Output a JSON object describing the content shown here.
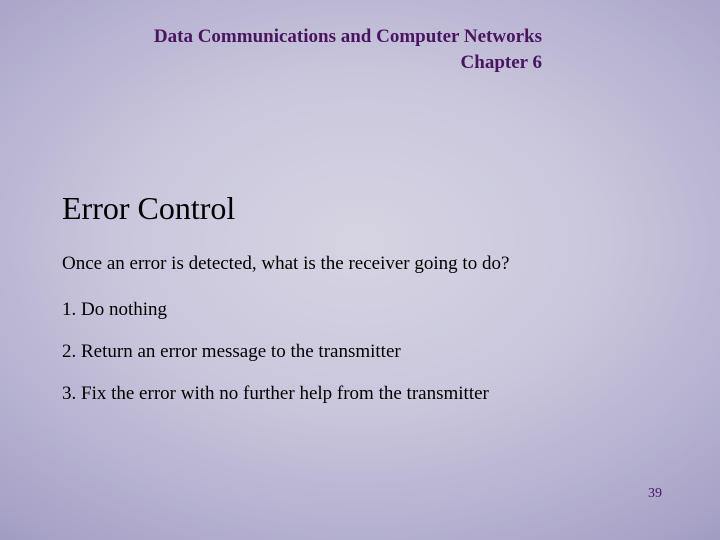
{
  "header": {
    "course": "Data Communications and Computer Networks",
    "chapter": "Chapter 6"
  },
  "main": {
    "title": "Error Control",
    "lead": "Once an error is detected, what is the receiver going to do?",
    "items": [
      "1. Do nothing",
      "2. Return an error message to the transmitter",
      "3. Fix the error with no further help from the transmitter"
    ]
  },
  "page_number": "39"
}
